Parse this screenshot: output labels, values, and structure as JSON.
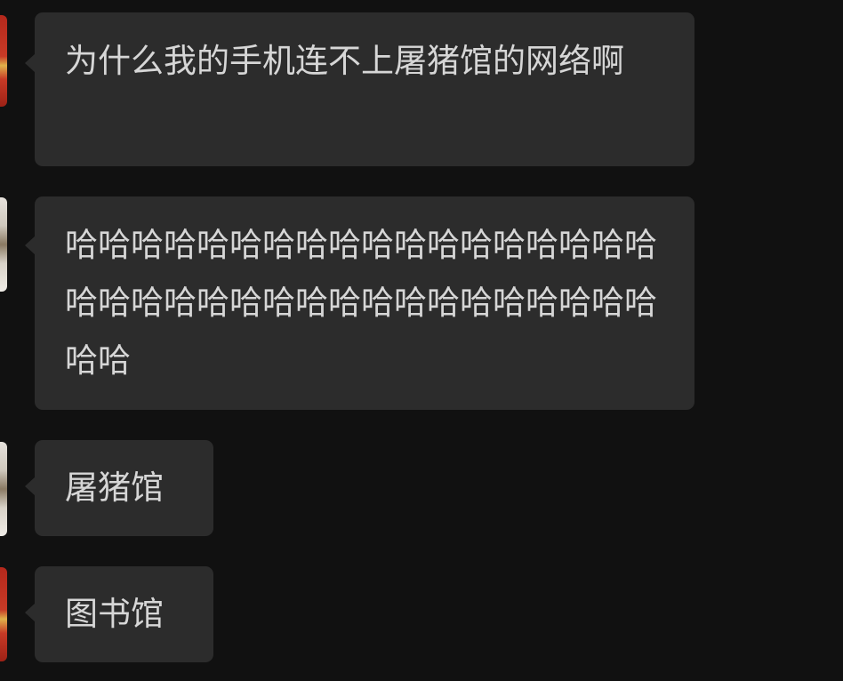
{
  "colors": {
    "background": "#111111",
    "bubble": "#2c2c2c",
    "text": "#d6d6d6"
  },
  "messages": [
    {
      "text": "为什么我的手机连不上屠猪馆的网络啊",
      "avatar": "red"
    },
    {
      "text": "哈哈哈哈哈哈哈哈哈哈哈哈哈哈哈哈哈哈哈哈哈哈哈哈哈哈哈哈哈哈哈哈哈哈哈哈哈哈",
      "avatar": "light"
    },
    {
      "text": "屠猪馆",
      "avatar": "light"
    },
    {
      "text": "图书馆",
      "avatar": "red"
    }
  ]
}
